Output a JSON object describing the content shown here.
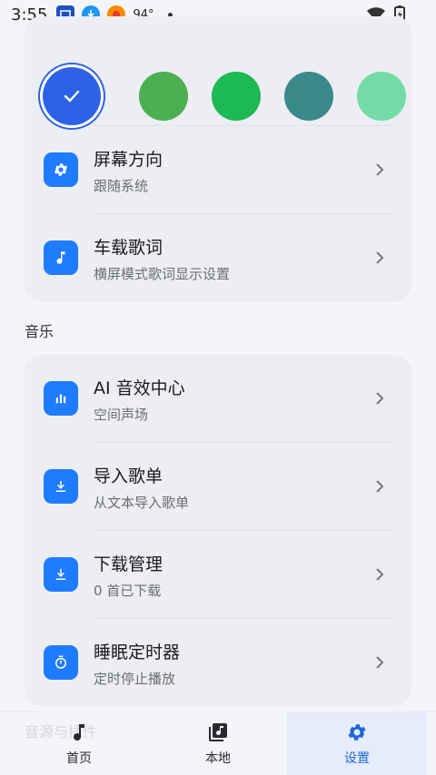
{
  "status_bar": {
    "time": "3:55",
    "temperature": "94°",
    "icons": [
      "screen-cast-icon",
      "download-icon",
      "news-app-icon",
      "wifi-icon",
      "battery-charging-icon"
    ]
  },
  "theme": {
    "swatches": [
      {
        "name": "blue",
        "color": "#2d62e6",
        "selected": true
      },
      {
        "name": "green",
        "color": "#4caf50",
        "selected": false
      },
      {
        "name": "emerald",
        "color": "#1db954",
        "selected": false
      },
      {
        "name": "teal",
        "color": "#3a8a8c",
        "selected": false
      },
      {
        "name": "mint",
        "color": "#74dba8",
        "selected": false
      }
    ]
  },
  "settings_top": [
    {
      "title": "屏幕方向",
      "subtitle": "跟随系统",
      "icon": "gear-icon"
    },
    {
      "title": "车载歌词",
      "subtitle": "横屏模式歌词显示设置",
      "icon": "music-note-icon"
    }
  ],
  "music_section": {
    "header": "音乐",
    "items": [
      {
        "title": "AI 音效中心",
        "subtitle": "空间声场",
        "icon": "equalizer-icon"
      },
      {
        "title": "导入歌单",
        "subtitle": "从文本导入歌单",
        "icon": "download-icon"
      },
      {
        "title": "下载管理",
        "subtitle": "0 首已下载",
        "icon": "download-icon"
      },
      {
        "title": "睡眠定时器",
        "subtitle": "定时停止播放",
        "icon": "timer-icon"
      }
    ]
  },
  "bottom_nav": {
    "ghost_text": "音源与插件",
    "items": [
      {
        "label": "首页",
        "icon": "music-note-icon",
        "active": false
      },
      {
        "label": "本地",
        "icon": "library-icon",
        "active": false
      },
      {
        "label": "设置",
        "icon": "gear-icon",
        "active": true
      }
    ]
  },
  "colors": {
    "accent": "#1f7bff",
    "active_nav": "#1f66d8"
  }
}
